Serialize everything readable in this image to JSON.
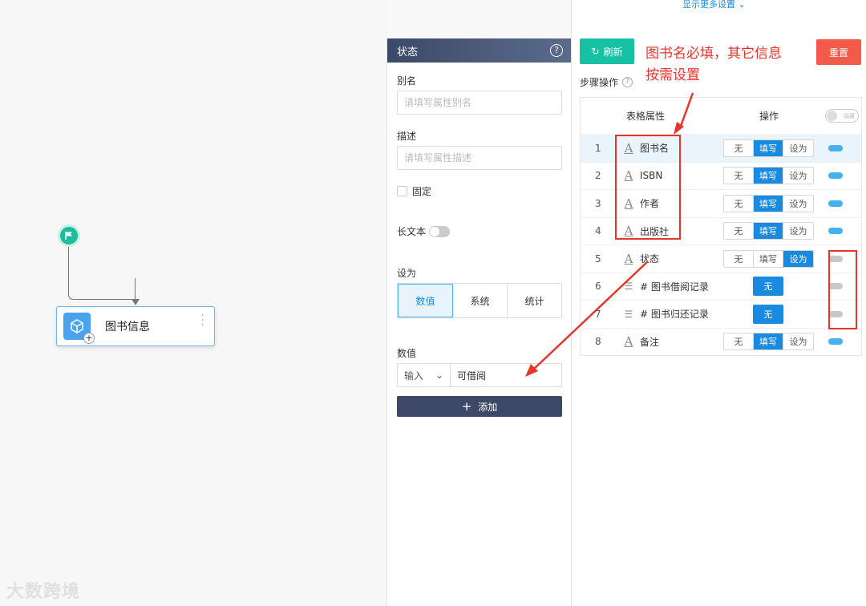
{
  "canvas": {
    "node_label": "图书信息",
    "watermark": "大数跨境"
  },
  "state_panel": {
    "title": "状态",
    "alias_label": "别名",
    "alias_placeholder": "请填写属性别名",
    "desc_label": "描述",
    "desc_placeholder": "请填写属性描述",
    "fixed_label": "固定",
    "longtext_label": "长文本",
    "setas_label": "设为",
    "setas_options": [
      "数值",
      "系统",
      "统计"
    ],
    "setas_selected": "数值",
    "value_label": "数值",
    "value_type": "输入",
    "value_text": "可借阅",
    "add_label": "添加"
  },
  "right_panel": {
    "more_settings": "显示更多设置",
    "refresh_label": "刷新",
    "reset_label": "重置",
    "annotation_line1": "图书名必填，其它信息",
    "annotation_line2": "按需设置",
    "steps_label": "步骤操作",
    "header_attr": "表格属性",
    "header_op": "操作",
    "hide_label": "隐藏",
    "op_none": "无",
    "op_fill": "填写",
    "op_set": "设为",
    "rows": [
      {
        "num": "1",
        "icon": "text-icon",
        "name": "图书名",
        "type": "triple",
        "active": "填写",
        "visible": true
      },
      {
        "num": "2",
        "icon": "text-icon",
        "name": "ISBN",
        "type": "triple",
        "active": "填写",
        "visible": true
      },
      {
        "num": "3",
        "icon": "text-icon",
        "name": "作者",
        "type": "triple",
        "active": "填写",
        "visible": true
      },
      {
        "num": "4",
        "icon": "text-icon",
        "name": "出版社",
        "type": "triple",
        "active": "填写",
        "visible": true
      },
      {
        "num": "5",
        "icon": "text-icon",
        "name": "状态",
        "type": "triple",
        "active": "设为",
        "visible": false
      },
      {
        "num": "6",
        "icon": "list-icon",
        "name": "# 图书借阅记录",
        "type": "single",
        "active": "无",
        "visible": false
      },
      {
        "num": "7",
        "icon": "list-icon",
        "name": "# 图书归还记录",
        "type": "single",
        "active": "无",
        "visible": false
      },
      {
        "num": "8",
        "icon": "text-icon",
        "name": "备注",
        "type": "triple",
        "active": "填写",
        "visible": true
      }
    ]
  },
  "colors": {
    "accent_blue": "#1a8ae0",
    "refresh_green": "#16c2a3",
    "reset_red": "#f25a4a",
    "annotation_red": "#e8352a",
    "panel_header": "#3d4966"
  }
}
